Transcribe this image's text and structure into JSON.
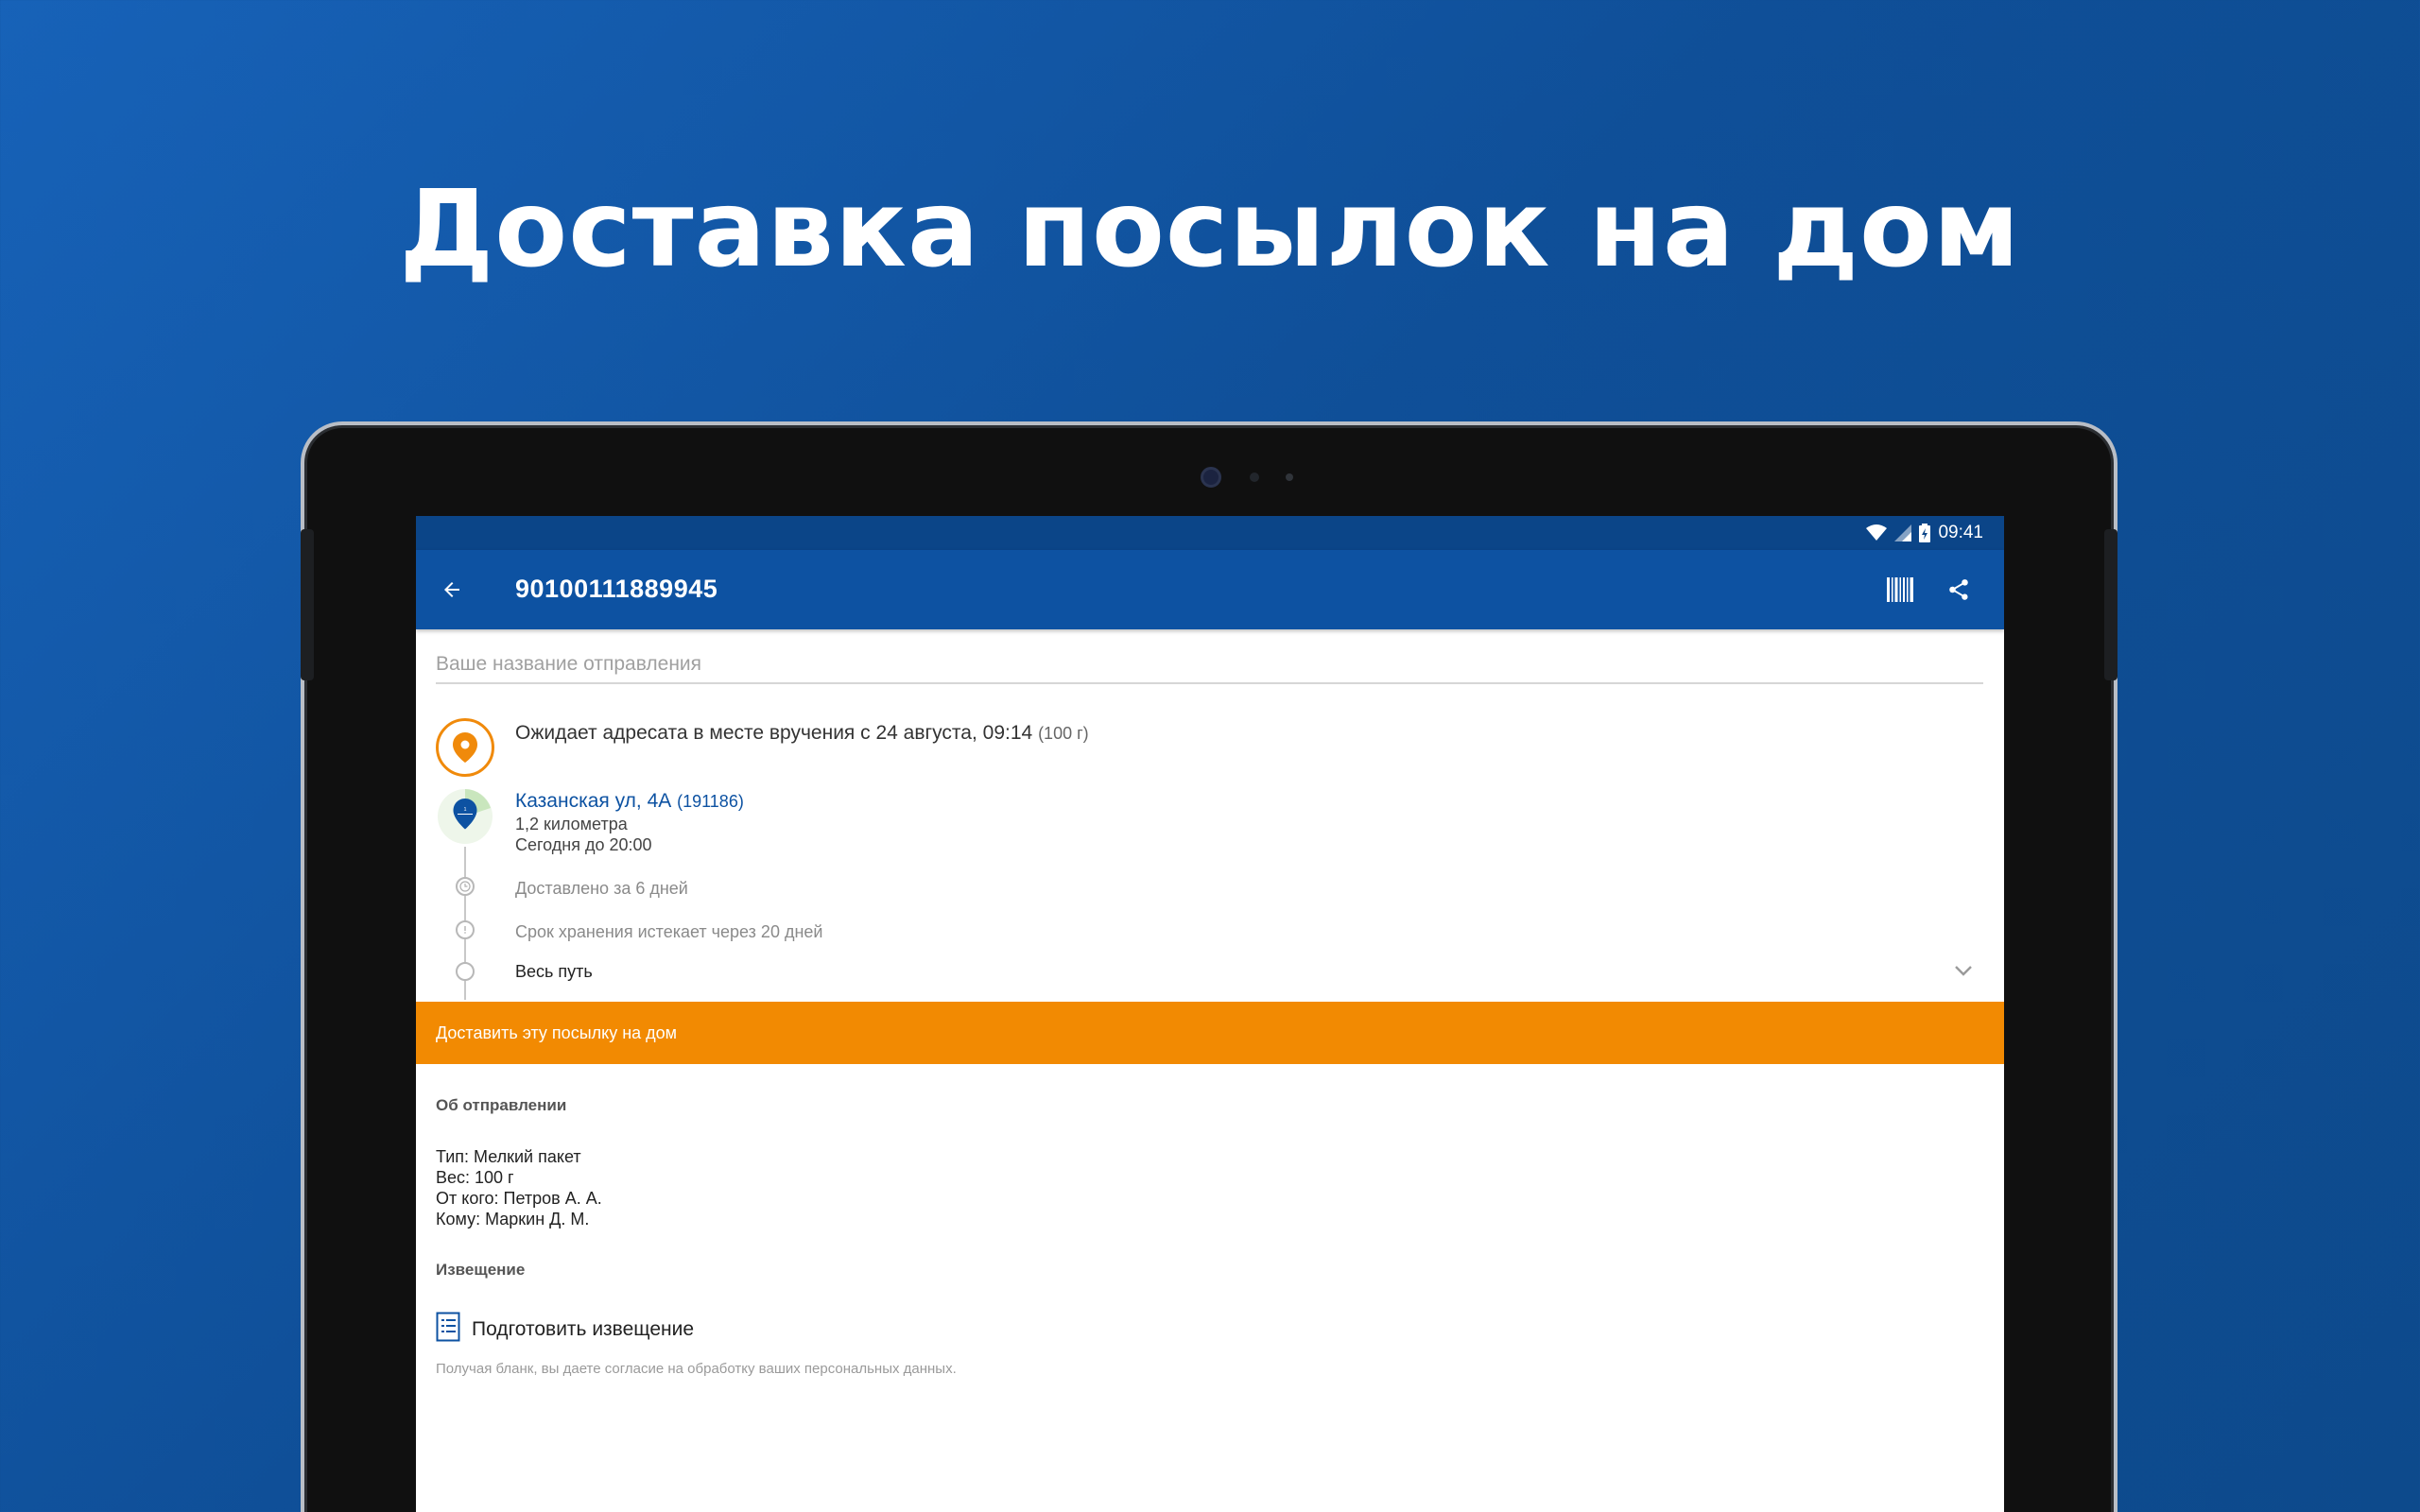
{
  "headline": "Доставка посылок на дом",
  "status_bar": {
    "time": "09:41"
  },
  "app_bar": {
    "title": "90100111889945",
    "icons": [
      "back-arrow-icon",
      "barcode-icon",
      "share-icon"
    ]
  },
  "name_field": {
    "placeholder": "Ваше название отправления",
    "value": ""
  },
  "status": {
    "text": "Ожидает адресата в месте вручения с 24 августа, 09:14",
    "weight": "(100 г)"
  },
  "office": {
    "address": "Казанская ул, 4А",
    "zip": "(191186)",
    "distance": "1,2 километра",
    "hours": "Сегодня до 20:00"
  },
  "timeline": {
    "delivered": "Доставлено за 6 дней",
    "storage": "Срок хранения истекает через 20 дней",
    "full_path": "Весь путь"
  },
  "deliver_button": "Доставить эту посылку на дом",
  "about": {
    "title": "Об отправлении",
    "type": "Тип: Мелкий пакет",
    "weight": "Вес: 100 г",
    "from": "От кого: Петров А. А.",
    "to": "Кому: Маркин Д. М."
  },
  "notice": {
    "title": "Извещение",
    "prepare": "Подготовить извещение",
    "disclaimer": "Получая бланк, вы даете согласие на обработку ваших персональных данных."
  },
  "colors": {
    "brand_blue": "#0d52a2",
    "status_bar_blue": "#0b4588",
    "accent_orange": "#f28a02",
    "background_blue": "#1560b4"
  }
}
